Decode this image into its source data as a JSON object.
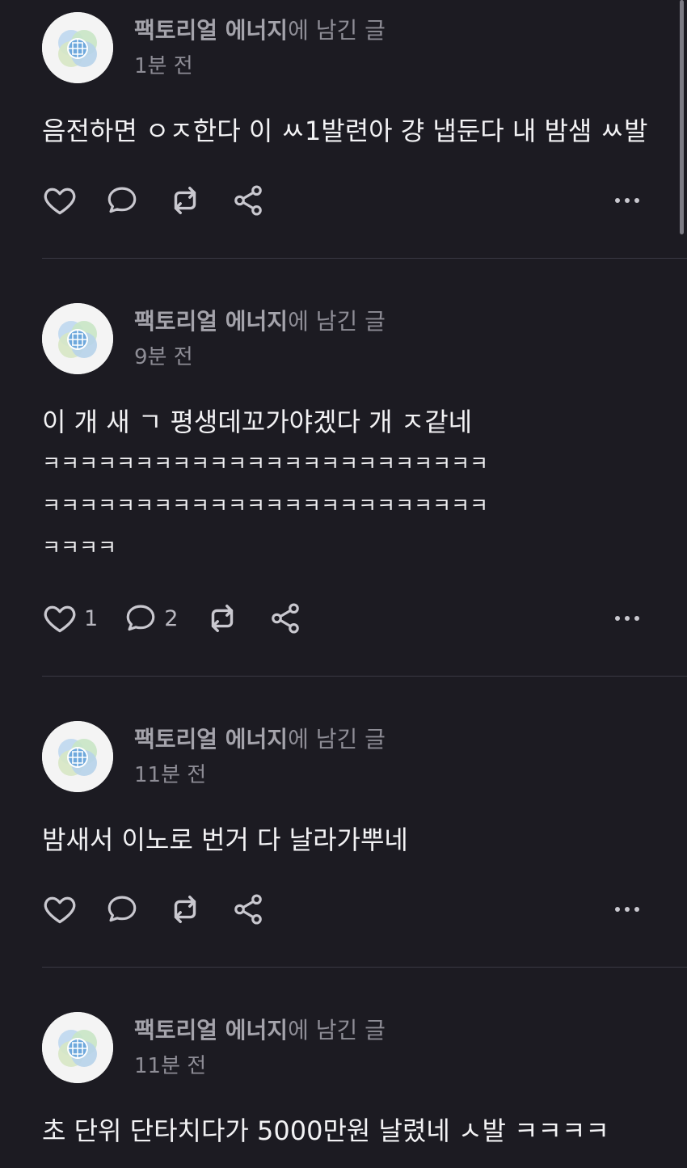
{
  "posts": [
    {
      "author": "팩토리얼 에너지",
      "author_suffix": "에 남긴 글",
      "time": "1분 전",
      "lines": [
        "음전하면 ㅇㅈ한다 이 ㅆ1발련아 걍 냅둔다 내 밤샘 ㅆ발"
      ],
      "likes": "",
      "comments": ""
    },
    {
      "author": "팩토리얼 에너지",
      "author_suffix": "에 남긴 글",
      "time": "9분 전",
      "lines": [
        "이 개 새 ㄱ 평생데꼬가야겠다 개 ㅈ같네",
        "ㅋㅋㅋㅋㅋㅋㅋㅋㅋㅋㅋㅋㅋㅋㅋㅋㅋㅋㅋㅋㅋㅋㅋㅋ",
        "ㅋㅋㅋㅋㅋㅋㅋㅋㅋㅋㅋㅋㅋㅋㅋㅋㅋㅋㅋㅋㅋㅋㅋㅋ",
        "ㅋㅋㅋㅋ"
      ],
      "likes": "1",
      "comments": "2"
    },
    {
      "author": "팩토리얼 에너지",
      "author_suffix": "에 남긴 글",
      "time": "11분 전",
      "lines": [
        "밤새서 이노로 번거 다 날라가뿌네"
      ],
      "likes": "",
      "comments": ""
    },
    {
      "author": "팩토리얼 에너지",
      "author_suffix": "에 남긴 글",
      "time": "11분 전",
      "lines": [
        "초 단위 단타치다가 5000만원 날렸네 ㅅ발 ㅋㅋㅋㅋ"
      ],
      "likes": "",
      "comments": ""
    }
  ],
  "icons": {
    "like": "heart-icon",
    "comment": "comment-bubble-icon",
    "repost": "repost-icon",
    "share": "share-icon",
    "more": "more-dots-icon"
  },
  "colors": {
    "background": "#1c1b22",
    "text": "#f2f2f4",
    "secondary_text": "#8e8d96",
    "icon": "#c9c8cf"
  }
}
